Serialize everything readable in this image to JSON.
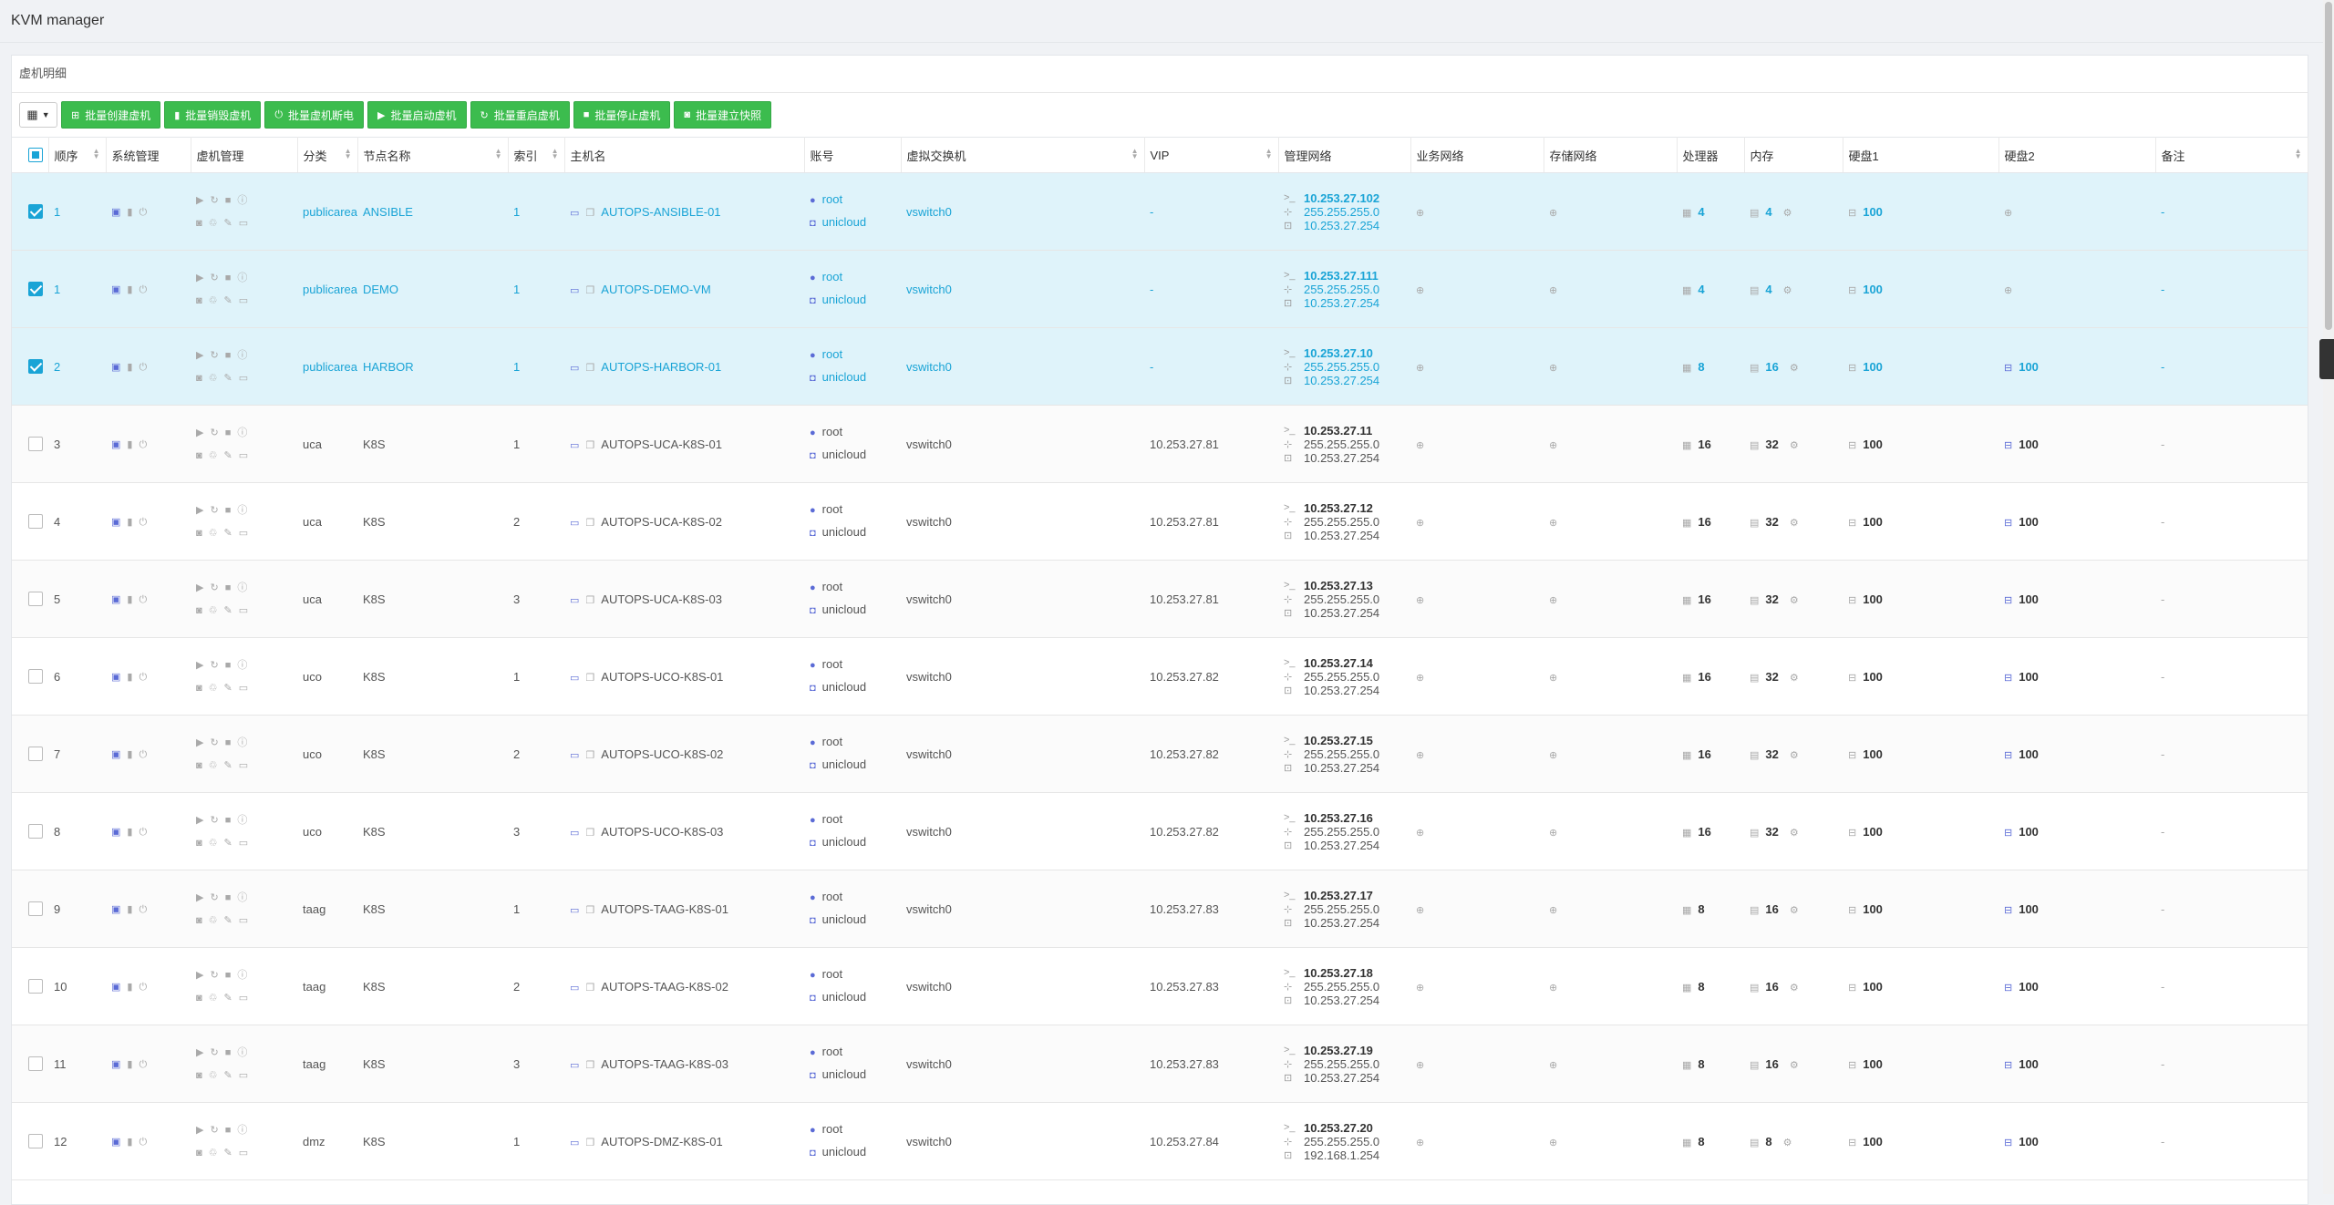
{
  "app": {
    "title": "KVM manager"
  },
  "panel": {
    "title": "虚机明细"
  },
  "toolbar": {
    "column_toggle_icon": "grid-icon",
    "buttons": [
      {
        "label": "批量创建虚机",
        "icon": "plus-square-icon"
      },
      {
        "label": "批量销毁虚机",
        "icon": "trash-icon"
      },
      {
        "label": "批量虚机断电",
        "icon": "power-icon"
      },
      {
        "label": "批量启动虚机",
        "icon": "play-icon"
      },
      {
        "label": "批量重启虚机",
        "icon": "refresh-icon"
      },
      {
        "label": "批量停止虚机",
        "icon": "stop-icon"
      },
      {
        "label": "批量建立快照",
        "icon": "camera-icon"
      }
    ]
  },
  "colors": {
    "accent": "#1aa4d6",
    "button_green": "#3cbc4e",
    "selected_row": "#dff3fa"
  },
  "table": {
    "headers": [
      "顺序",
      "系统管理",
      "虚机管理",
      "分类",
      "节点名称",
      "索引",
      "主机名",
      "账号",
      "虚拟交换机",
      "VIP",
      "管理网络",
      "业务网络",
      "存储网络",
      "处理器",
      "内存",
      "硬盘1",
      "硬盘2",
      "备注"
    ],
    "rows": [
      {
        "selected": true,
        "order": "1",
        "category": "publicarea",
        "node": "ANSIBLE",
        "index": "1",
        "hostname": "AUTOPS-ANSIBLE-01",
        "user": "root",
        "password": "unicloud",
        "vswitch": "vswitch0",
        "vip": "-",
        "ip": "10.253.27.102",
        "mask": "255.255.255.0",
        "gateway": "10.253.27.254",
        "cpu": "4",
        "mem": "4",
        "disk1": "100",
        "disk2": "",
        "remark": "-"
      },
      {
        "selected": true,
        "order": "1",
        "category": "publicarea",
        "node": "DEMO",
        "index": "1",
        "hostname": "AUTOPS-DEMO-VM",
        "user": "root",
        "password": "unicloud",
        "vswitch": "vswitch0",
        "vip": "-",
        "ip": "10.253.27.111",
        "mask": "255.255.255.0",
        "gateway": "10.253.27.254",
        "cpu": "4",
        "mem": "4",
        "disk1": "100",
        "disk2": "",
        "remark": "-"
      },
      {
        "selected": true,
        "order": "2",
        "category": "publicarea",
        "node": "HARBOR",
        "index": "1",
        "hostname": "AUTOPS-HARBOR-01",
        "user": "root",
        "password": "unicloud",
        "vswitch": "vswitch0",
        "vip": "-",
        "ip": "10.253.27.10",
        "mask": "255.255.255.0",
        "gateway": "10.253.27.254",
        "cpu": "8",
        "mem": "16",
        "disk1": "100",
        "disk2": "100",
        "remark": "-"
      },
      {
        "selected": false,
        "order": "3",
        "category": "uca",
        "node": "K8S",
        "index": "1",
        "hostname": "AUTOPS-UCA-K8S-01",
        "user": "root",
        "password": "unicloud",
        "vswitch": "vswitch0",
        "vip": "10.253.27.81",
        "ip": "10.253.27.11",
        "mask": "255.255.255.0",
        "gateway": "10.253.27.254",
        "cpu": "16",
        "mem": "32",
        "disk1": "100",
        "disk2": "100",
        "remark": "-"
      },
      {
        "selected": false,
        "order": "4",
        "category": "uca",
        "node": "K8S",
        "index": "2",
        "hostname": "AUTOPS-UCA-K8S-02",
        "user": "root",
        "password": "unicloud",
        "vswitch": "vswitch0",
        "vip": "10.253.27.81",
        "ip": "10.253.27.12",
        "mask": "255.255.255.0",
        "gateway": "10.253.27.254",
        "cpu": "16",
        "mem": "32",
        "disk1": "100",
        "disk2": "100",
        "remark": "-"
      },
      {
        "selected": false,
        "order": "5",
        "category": "uca",
        "node": "K8S",
        "index": "3",
        "hostname": "AUTOPS-UCA-K8S-03",
        "user": "root",
        "password": "unicloud",
        "vswitch": "vswitch0",
        "vip": "10.253.27.81",
        "ip": "10.253.27.13",
        "mask": "255.255.255.0",
        "gateway": "10.253.27.254",
        "cpu": "16",
        "mem": "32",
        "disk1": "100",
        "disk2": "100",
        "remark": "-"
      },
      {
        "selected": false,
        "order": "6",
        "category": "uco",
        "node": "K8S",
        "index": "1",
        "hostname": "AUTOPS-UCO-K8S-01",
        "user": "root",
        "password": "unicloud",
        "vswitch": "vswitch0",
        "vip": "10.253.27.82",
        "ip": "10.253.27.14",
        "mask": "255.255.255.0",
        "gateway": "10.253.27.254",
        "cpu": "16",
        "mem": "32",
        "disk1": "100",
        "disk2": "100",
        "remark": "-"
      },
      {
        "selected": false,
        "order": "7",
        "category": "uco",
        "node": "K8S",
        "index": "2",
        "hostname": "AUTOPS-UCO-K8S-02",
        "user": "root",
        "password": "unicloud",
        "vswitch": "vswitch0",
        "vip": "10.253.27.82",
        "ip": "10.253.27.15",
        "mask": "255.255.255.0",
        "gateway": "10.253.27.254",
        "cpu": "16",
        "mem": "32",
        "disk1": "100",
        "disk2": "100",
        "remark": "-"
      },
      {
        "selected": false,
        "order": "8",
        "category": "uco",
        "node": "K8S",
        "index": "3",
        "hostname": "AUTOPS-UCO-K8S-03",
        "user": "root",
        "password": "unicloud",
        "vswitch": "vswitch0",
        "vip": "10.253.27.82",
        "ip": "10.253.27.16",
        "mask": "255.255.255.0",
        "gateway": "10.253.27.254",
        "cpu": "16",
        "mem": "32",
        "disk1": "100",
        "disk2": "100",
        "remark": "-"
      },
      {
        "selected": false,
        "order": "9",
        "category": "taag",
        "node": "K8S",
        "index": "1",
        "hostname": "AUTOPS-TAAG-K8S-01",
        "user": "root",
        "password": "unicloud",
        "vswitch": "vswitch0",
        "vip": "10.253.27.83",
        "ip": "10.253.27.17",
        "mask": "255.255.255.0",
        "gateway": "10.253.27.254",
        "cpu": "8",
        "mem": "16",
        "disk1": "100",
        "disk2": "100",
        "remark": "-"
      },
      {
        "selected": false,
        "order": "10",
        "category": "taag",
        "node": "K8S",
        "index": "2",
        "hostname": "AUTOPS-TAAG-K8S-02",
        "user": "root",
        "password": "unicloud",
        "vswitch": "vswitch0",
        "vip": "10.253.27.83",
        "ip": "10.253.27.18",
        "mask": "255.255.255.0",
        "gateway": "10.253.27.254",
        "cpu": "8",
        "mem": "16",
        "disk1": "100",
        "disk2": "100",
        "remark": "-"
      },
      {
        "selected": false,
        "order": "11",
        "category": "taag",
        "node": "K8S",
        "index": "3",
        "hostname": "AUTOPS-TAAG-K8S-03",
        "user": "root",
        "password": "unicloud",
        "vswitch": "vswitch0",
        "vip": "10.253.27.83",
        "ip": "10.253.27.19",
        "mask": "255.255.255.0",
        "gateway": "10.253.27.254",
        "cpu": "8",
        "mem": "16",
        "disk1": "100",
        "disk2": "100",
        "remark": "-"
      },
      {
        "selected": false,
        "order": "12",
        "category": "dmz",
        "node": "K8S",
        "index": "1",
        "hostname": "AUTOPS-DMZ-K8S-01",
        "user": "root",
        "password": "unicloud",
        "vswitch": "vswitch0",
        "vip": "10.253.27.84",
        "ip": "10.253.27.20",
        "mask": "255.255.255.0",
        "gateway": "192.168.1.254",
        "cpu": "8",
        "mem": "8",
        "disk1": "100",
        "disk2": "100",
        "remark": "-"
      }
    ]
  }
}
